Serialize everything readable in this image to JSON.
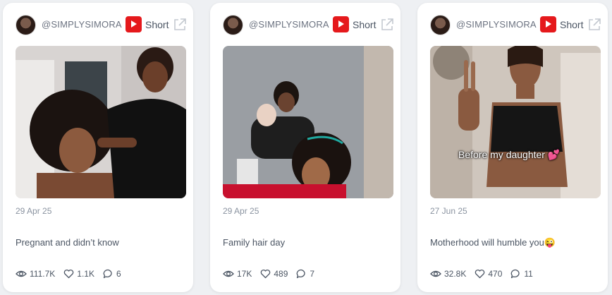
{
  "cards": [
    {
      "username": "@SIMPLYSIMORA",
      "type": "Short",
      "date": "29 Apr 25",
      "caption": "Pregnant and didn’t know",
      "views": "111.7K",
      "likes": "1.1K",
      "comments": "6",
      "overlay_text": ""
    },
    {
      "username": "@SIMPLYSIMORA",
      "type": "Short",
      "date": "29 Apr 25",
      "caption": "Family hair day",
      "views": "17K",
      "likes": "489",
      "comments": "7",
      "overlay_text": ""
    },
    {
      "username": "@SIMPLYSIMORA",
      "type": "Short",
      "date": "27 Jun 25",
      "caption": "Motherhood will humble you😜",
      "views": "32.8K",
      "likes": "470",
      "comments": "11",
      "overlay_text": "Before my daughter 💕"
    }
  ],
  "icons": {
    "platform": "youtube-icon",
    "external": "external-link-icon",
    "views": "eye-icon",
    "likes": "heart-icon",
    "comments": "comment-icon"
  },
  "colors": {
    "youtube_red": "#e5191c",
    "card_bg": "#ffffff",
    "page_bg": "#eef0f3"
  }
}
